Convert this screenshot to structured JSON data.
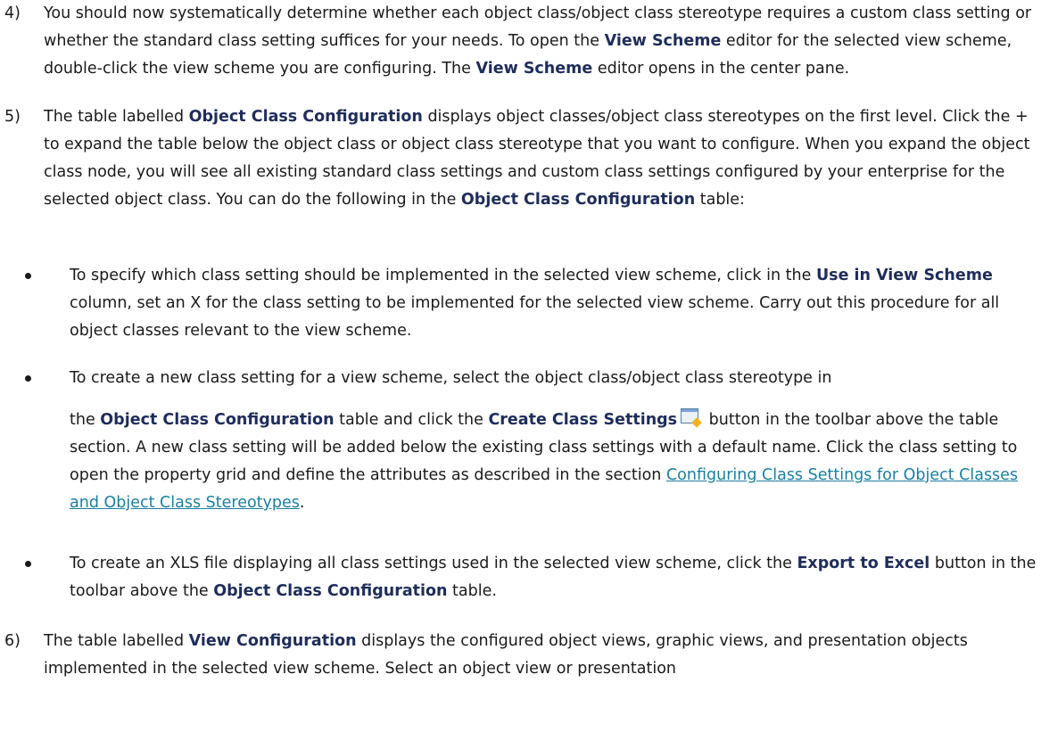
{
  "step4": {
    "num": "4)",
    "t1": "You should now systematically determine whether each object class/object class stereotype requires a custom class setting or whether the standard class setting suffices for your needs. To open the ",
    "b1": "View Scheme",
    "t2": " editor for the selected view scheme, double-click the view scheme you are configuring. The ",
    "b2": "View Scheme",
    "t3": " editor opens in the center pane."
  },
  "step5": {
    "num": "5)",
    "t1": "The table labelled ",
    "b1": "Object Class Configuration",
    "t2": " displays object classes/object class stereotypes on the first level. Click the + to expand the table below the object class or object class stereotype that you want to configure. When you expand the object class node, you will see all existing standard class settings and custom class settings configured by your enterprise for the selected object class. You can do the following in the ",
    "b2": "Object Class Configuration",
    "t3": " table:"
  },
  "bullet1": {
    "t1": "To specify which class setting should be implemented in the selected view scheme, click in the ",
    "b1": "Use in View Scheme",
    "t2": " column, set an X for the class setting to be implemented for the selected view scheme. Carry out this procedure for all object classes relevant to the view scheme."
  },
  "bullet2": {
    "t1": "To create a new class setting for a view scheme, select the object class/object class stereotype in",
    "t2": "the ",
    "b1": "Object Class Configuration",
    "t3": " table and click the ",
    "b2": "Create Class Settings",
    "icon": "create-class-settings-icon",
    "t4": " button in the toolbar above the table section. A new class setting will be added below the existing class settings with a default name. Click the class setting to open the property grid and define the attributes as described in the section ",
    "link": "Configuring Class Settings for Object Classes and Object Class Stereotypes",
    "t5": "."
  },
  "bullet3": {
    "t1": "To create an XLS file displaying all class settings used in the selected view scheme, click the ",
    "b1": "Export to Excel",
    "t2": " button in the toolbar above the ",
    "b2": "Object Class Configuration",
    "t3": " table."
  },
  "step6": {
    "num": "6)",
    "t1": "The table labelled ",
    "b1": "View Configuration",
    "t2": " displays the configured object views, graphic views, and presentation objects implemented in the selected view scheme. Select an object view or presentation"
  }
}
